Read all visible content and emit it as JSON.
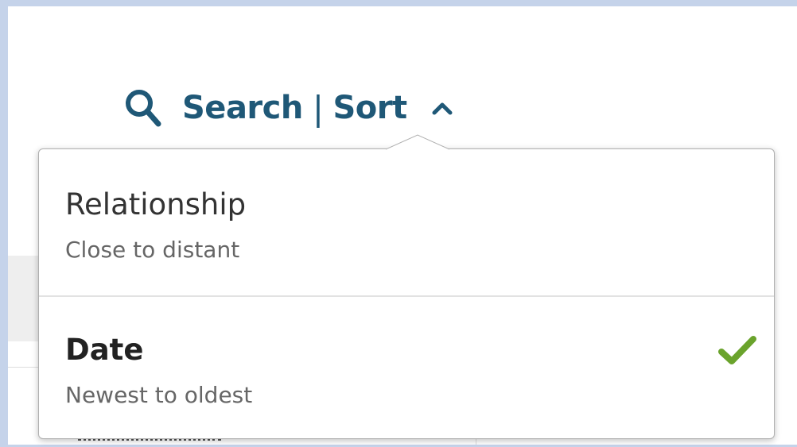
{
  "toolbar": {
    "search_label": "Search",
    "separator": "|",
    "sort_label": "Sort",
    "search_icon": "search-icon",
    "sort_toggle_icon": "chevron-up-icon"
  },
  "sort_menu": {
    "options": [
      {
        "label": "Relationship",
        "description": "Close to distant",
        "selected": false
      },
      {
        "label": "Date",
        "description": "Newest to oldest",
        "selected": true
      }
    ],
    "selected_icon": "checkmark-icon"
  },
  "colors": {
    "accent": "#1f5877",
    "check": "#6aa32c",
    "window_bg": "#c5d3ea"
  }
}
